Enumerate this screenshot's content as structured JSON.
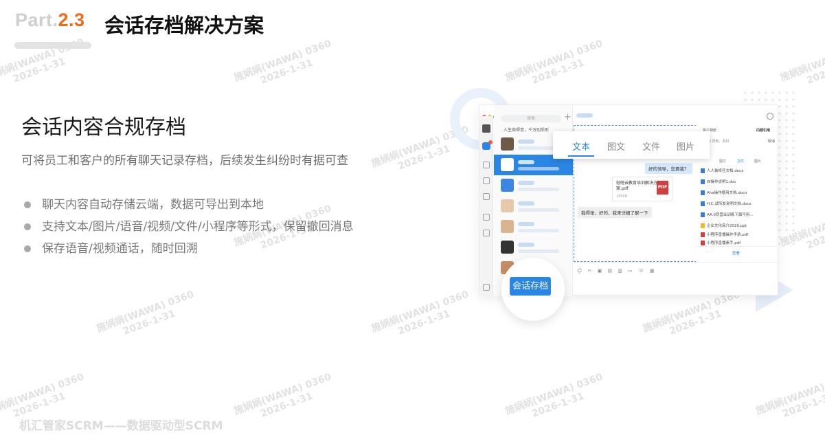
{
  "header": {
    "part_prefix": "Part.",
    "part_number": "2.3",
    "title": "会话存档解决方案"
  },
  "content": {
    "subtitle": "会话内容合规存档",
    "description": "可将员工和客户的所有聊天记录存档，后续发生纠纷时有据可查",
    "bullets": [
      "聊天内容自动存储云端，数据可导出到本地",
      "支持文本/图片/语音/视频/文件/小程序等形式，保留撤回消息",
      "保存语音/视频通话，随时回溯"
    ]
  },
  "footer": {
    "text": "机汇管家SCRM——数据驱动型SCRM"
  },
  "watermark": {
    "line1": "施娲娲(WAWA) 0360",
    "line2": "2026-1-31"
  },
  "mockup": {
    "search_placeholder": "搜索",
    "plus_icon": "+",
    "pinned_text": "人生商得意，千万别后形",
    "popup_tabs": [
      "文本",
      "图文",
      "文件",
      "图片"
    ],
    "bubble_right": "好的领导，您费我？",
    "file_card": {
      "name": "轻啥云教育培训解决方案.pdf",
      "size": "286KB",
      "type": "PDF"
    },
    "bubble_left": "我得张，好的，我来详细了解一下",
    "toolbar_icons": "☺ ✂ ▣ ▤ ▥ ▭ ☏ ▦",
    "side_panel": {
      "header_left": "客户相册",
      "header_right": "内部引用",
      "search": "Q 搜索，素材",
      "search_action": "取消",
      "tabs": [
        "图文",
        "文件",
        "图片"
      ],
      "files": [
        {
          "name": "人人装修任文档.docx",
          "kind": "doc"
        },
        {
          "name": "W操作说明1.doc",
          "kind": "doc"
        },
        {
          "name": "Aha操作使用文档.docx",
          "kind": "doc"
        },
        {
          "name": "H.C.试所发说明文档.docx",
          "kind": "doc"
        },
        {
          "name": "AA.0同营业训练下面可用...",
          "kind": "doc"
        },
        {
          "name": "企业文化简介2020.ppt",
          "kind": "ppt"
        },
        {
          "name": "小程序直播操作手册.pdf",
          "kind": "pdf"
        },
        {
          "name": "小程序直播素手.pdf",
          "kind": "pdf"
        }
      ],
      "more": "查看"
    },
    "archive_button": "会话存档"
  },
  "colors": {
    "accent_orange": "#f06a1b",
    "primary_blue": "#2a86e4"
  }
}
